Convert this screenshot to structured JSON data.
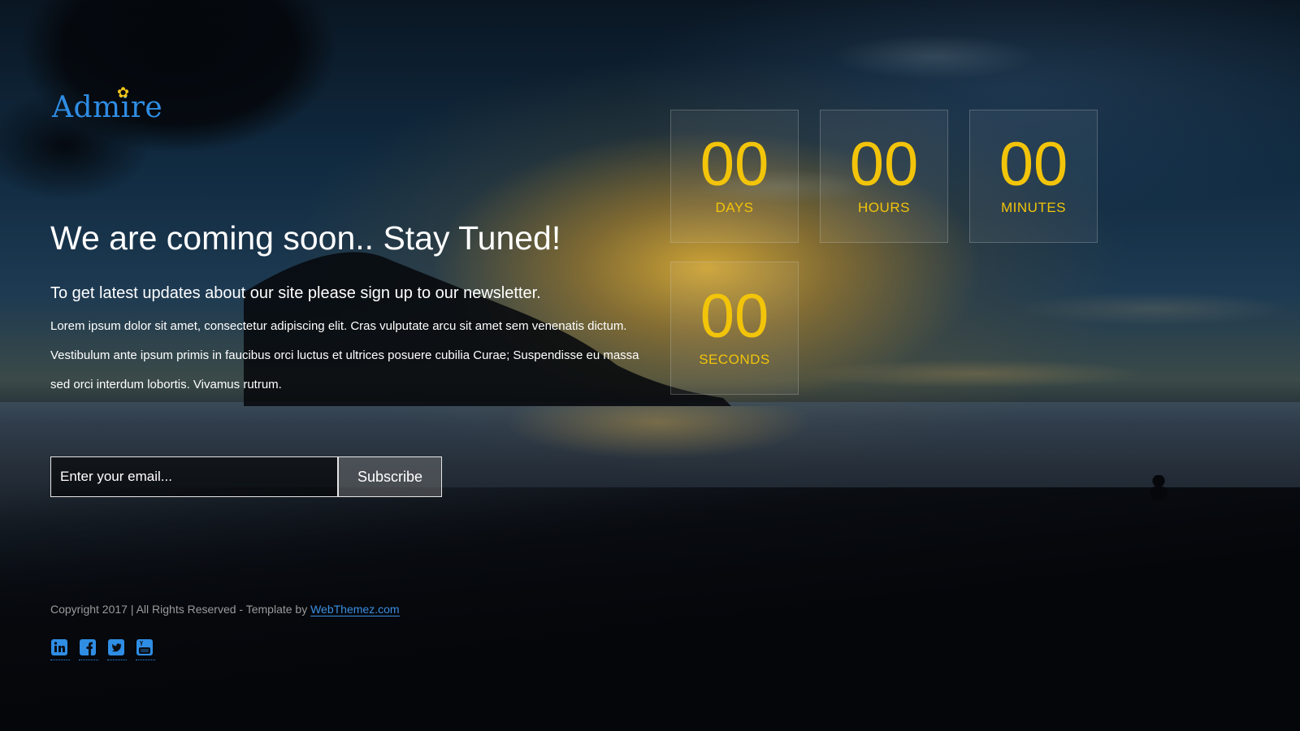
{
  "brand": {
    "logo_text": "Admire",
    "color": "#2f8de4",
    "accent_color": "#f0c419"
  },
  "hero": {
    "headline": "We are coming soon.. Stay Tuned!",
    "subheadline": "To get latest updates about our site please sign up to our newsletter.",
    "body": "Lorem ipsum dolor sit amet, consectetur adipiscing elit. Cras vulputate arcu sit amet sem venenatis dictum. Vestibulum ante ipsum primis in faucibus orci luctus et ultrices posuere cubilia Curae; Suspendisse eu massa sed orci interdum lobortis. Vivamus rutrum."
  },
  "newsletter": {
    "email_placeholder": "Enter your email...",
    "email_value": "",
    "subscribe_label": "Subscribe"
  },
  "countdown": {
    "color": "#f2c40a",
    "days": {
      "value": "00",
      "label": "DAYS"
    },
    "hours": {
      "value": "00",
      "label": "HOURS"
    },
    "minutes": {
      "value": "00",
      "label": "MINUTES"
    },
    "seconds": {
      "value": "00",
      "label": "SECONDS"
    }
  },
  "footer": {
    "copyright_prefix": "Copyright 2017 | All Rights Reserved - Template by ",
    "link_text": "WebThemez.com",
    "link_color": "#3b8fe0"
  },
  "social": {
    "color": "#2f8de4",
    "icons": [
      "linkedin-icon",
      "facebook-icon",
      "twitter-icon",
      "youtube-icon"
    ]
  }
}
